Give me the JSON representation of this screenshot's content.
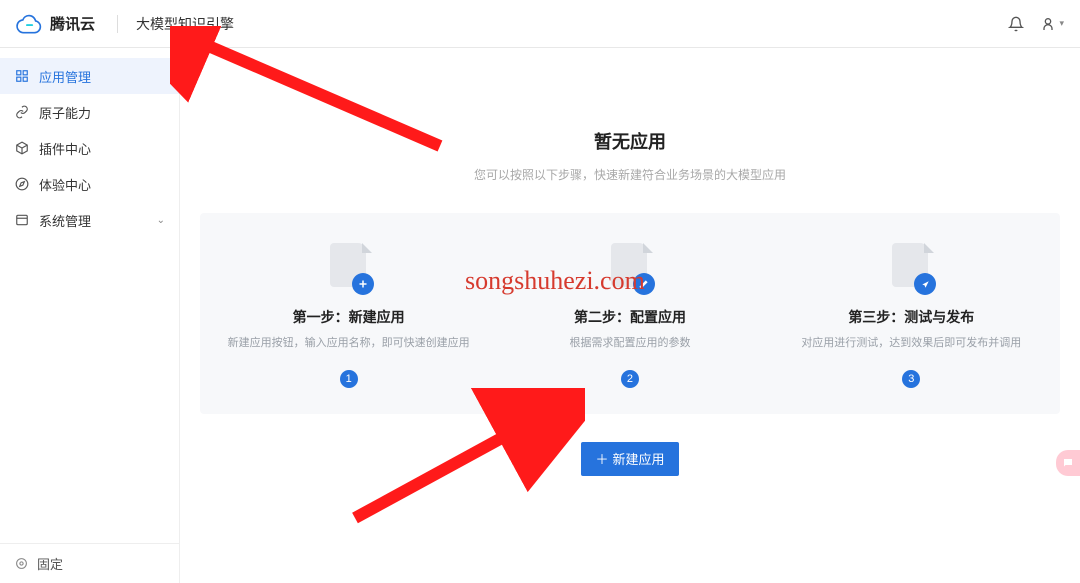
{
  "header": {
    "brand": "腾讯云",
    "product": "大模型知识引擎"
  },
  "sidebar": {
    "items": [
      {
        "label": "应用管理"
      },
      {
        "label": "原子能力"
      },
      {
        "label": "插件中心"
      },
      {
        "label": "体验中心"
      },
      {
        "label": "系统管理"
      }
    ],
    "footer": "固定"
  },
  "main": {
    "emptyTitle": "暂无应用",
    "emptySub": "您可以按照以下步骤，快速新建符合业务场景的大模型应用",
    "steps": [
      {
        "title": "第一步：新建应用",
        "desc": "新建应用按钮，输入应用名称，即可快速创建应用",
        "num": "1"
      },
      {
        "title": "第二步：配置应用",
        "desc": "根据需求配置应用的参数",
        "num": "2"
      },
      {
        "title": "第三步：测试与发布",
        "desc": "对应用进行测试，达到效果后即可发布并调用",
        "num": "3"
      }
    ],
    "createButton": "新建应用"
  },
  "watermark": "songshuhezi.com"
}
